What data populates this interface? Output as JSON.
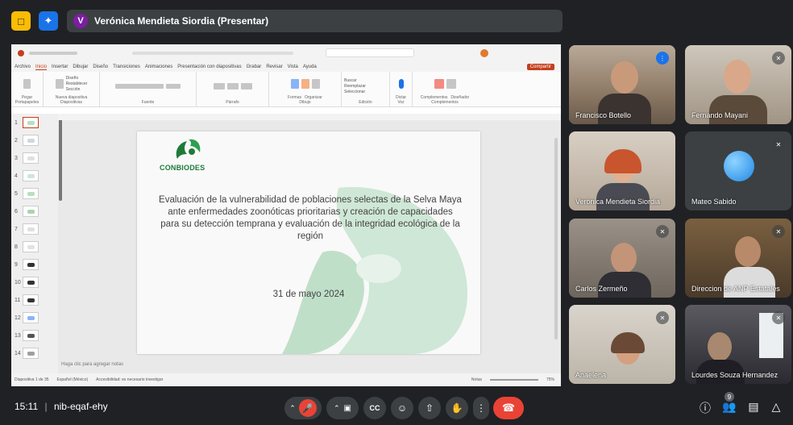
{
  "topbar": {
    "presenter_initial": "V",
    "presenter_label": "Verónica Mendieta Siordia (Presentar)"
  },
  "ppt": {
    "menu": [
      "Archivo",
      "Inicio",
      "Insertar",
      "Dibujar",
      "Diseño",
      "Transiciones",
      "Animaciones",
      "Presentación con diapositivas",
      "Grabar",
      "Revisar",
      "Vista",
      "Ayuda"
    ],
    "share_label": "Compartir",
    "ribbon_groups": [
      "Portapapeles",
      "Diapositivas",
      "Fuente",
      "Párrafo",
      "Dibujo",
      "Edición",
      "Voz",
      "Complementos"
    ],
    "ribbon_buttons": {
      "paste": "Pegar",
      "new_slide": "Nueva diapositiva",
      "layout": "Diseño",
      "reset": "Restablecer",
      "section": "Sección",
      "shapes": "Formas",
      "arrange": "Organizar",
      "find": "Buscar",
      "replace": "Reemplazar",
      "select": "Seleccionar",
      "dictate": "Dictar",
      "addins": "Complementos",
      "designer": "Diseñador"
    },
    "slide": {
      "logo_text": "CONBIODES",
      "title": "Evaluación de la vulnerabilidad de poblaciones selectas de la Selva Maya ante enfermedades zoonóticas prioritarias y creación de capacidades para su detección temprana y evaluación de la integridad ecológica de la región",
      "date": "31 de mayo 2024"
    },
    "thumb_numbers": [
      "1",
      "2",
      "3",
      "4",
      "5",
      "6",
      "7",
      "8",
      "9",
      "10",
      "11",
      "12",
      "13",
      "14"
    ],
    "notes_placeholder": "Haga clic para agregar notas",
    "status": {
      "slide_count": "Diapositiva 1 de 35",
      "language": "Español (México)",
      "accessibility": "Accesibilidad: es necesario investigar",
      "notes": "Notas",
      "zoom": "75%"
    }
  },
  "participants": [
    {
      "name": "Francisco Botello",
      "state": "speaking"
    },
    {
      "name": "Fernando Mayani",
      "state": "muted"
    },
    {
      "name": "Verónica Mendieta Siordia",
      "state": "none"
    },
    {
      "name": "Mateo Sabido",
      "state": "muted"
    },
    {
      "name": "Carlos Zermeño",
      "state": "muted"
    },
    {
      "name": "Direccion de ANP Estatales",
      "state": "muted"
    },
    {
      "name": "Anaelena",
      "state": "muted"
    },
    {
      "name": "Lourdes Souza Hernandez",
      "state": "muted"
    }
  ],
  "bottombar": {
    "time": "15:11",
    "meeting_code": "nib-eqaf-ehy",
    "participant_count": "9"
  },
  "colors": {
    "accent": "#1a73e8",
    "end_call": "#ea4335",
    "ppt_accent": "#c43e1c",
    "logo_green": "#1f7a3a"
  }
}
